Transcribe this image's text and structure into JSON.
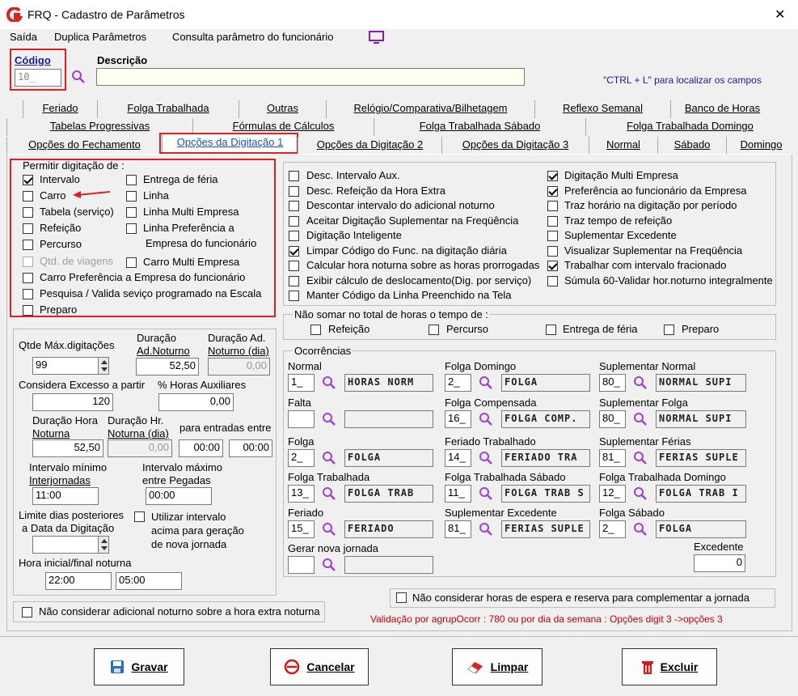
{
  "window": {
    "title": "FRQ - Cadastro de Parâmetros",
    "close": "✕"
  },
  "menu": [
    "Saída",
    "Duplica Parâmetros",
    "Consulta parâmetro do funcionário"
  ],
  "header": {
    "codigo_label": "Código",
    "codigo_value": "10_",
    "descricao_label": "Descrição",
    "descricao_value": "",
    "hint": "\"CTRL + L\" para localizar os campos"
  },
  "tabs_row1": [
    "Feriado",
    "Folga Trabalhada",
    "Outras",
    "Relógio/Comparativa/Bilhetagem",
    "Reflexo Semanal",
    "Banco de Horas"
  ],
  "tabs_row2": [
    "Tabelas Progressivas",
    "Fórmulas de Cálculos",
    "Folga Trabalhada Sábado",
    "Folga Trabalhada Domingo"
  ],
  "tabs_row3": [
    "Opções do Fechamento",
    "Opções da Digitação 1",
    "Opções da Digitação 2",
    "Opções da Digitação 3",
    "Normal",
    "Sábado",
    "Domingo"
  ],
  "permitir": {
    "title": "Permitir digitação de :",
    "left": [
      {
        "label": "Intervalo",
        "checked": true
      },
      {
        "label": "Carro",
        "checked": false
      },
      {
        "label": "Tabela (serviço)",
        "checked": false
      },
      {
        "label": "Refeição",
        "checked": false
      },
      {
        "label": "Percurso",
        "checked": false
      },
      {
        "label": "Qtd. de viagens",
        "checked": false,
        "disabled": true
      }
    ],
    "right": [
      {
        "label": "Entrega de féria",
        "checked": false
      },
      {
        "label": "Linha",
        "checked": false
      },
      {
        "label": "Linha Multi Empresa",
        "checked": false
      },
      {
        "label": "Linha Preferência a",
        "label2": "Empresa do funcionário",
        "checked": false
      },
      {
        "label": "Carro Multi Empresa",
        "checked": false
      }
    ],
    "bottom": [
      {
        "label": "Carro Preferência a Empresa do funcionário",
        "checked": false
      },
      {
        "label": "Pesquisa / Valida seviço programado na Escala",
        "checked": false
      },
      {
        "label": "Preparo",
        "checked": false
      }
    ]
  },
  "options_left": [
    {
      "label": "Desc. Intervalo Aux.",
      "checked": false
    },
    {
      "label": "Desc. Refeição da Hora Extra",
      "checked": false
    },
    {
      "label": "Descontar intervalo do adicional noturno",
      "checked": false
    },
    {
      "label": "Aceitar Digitação Suplementar na Freqüência",
      "checked": false
    },
    {
      "label": "Digitação Inteligente",
      "checked": false
    },
    {
      "label": "Limpar Código do Func. na digitação diária",
      "checked": true
    },
    {
      "label": "Calcular hora noturna sobre as horas prorrogadas",
      "checked": false
    },
    {
      "label": "Exibir cálculo de deslocamento(Dig. por serviço)",
      "checked": false
    },
    {
      "label": "Manter Código da Linha Preenchido na Tela",
      "checked": false
    }
  ],
  "options_right": [
    {
      "label": "Digitação Multi Empresa",
      "checked": true
    },
    {
      "label": "Preferência ao funcionário da Empresa",
      "checked": true
    },
    {
      "label": "Traz horário na digitação por período",
      "checked": false
    },
    {
      "label": "Traz tempo de refeição",
      "checked": false
    },
    {
      "label": "Suplementar Excedente",
      "checked": false
    },
    {
      "label": "Visualizar Suplementar na Freqüência",
      "checked": false
    },
    {
      "label": "Trabalhar com intervalo fracionado",
      "checked": true
    },
    {
      "label": "Súmula 60-Validar hor.noturno integralmente",
      "checked": false
    }
  ],
  "nao_somar": {
    "title": "Não somar no total de horas o tempo de :",
    "items": [
      "Refeição",
      "Percurso",
      "Entrega de féria",
      "Preparo"
    ]
  },
  "params": {
    "qtde_label": "Qtde Máx.digitações",
    "qtde": "99",
    "dur_ad_not_l1": "Duração",
    "dur_ad_not_l2": "Ad.Noturno",
    "dur_ad_not": "52,50",
    "dur_ad_not_dia_l1": "Duração Ad.",
    "dur_ad_not_dia_l2": "Noturno (dia)",
    "dur_ad_not_dia": "0,00",
    "excesso_label": "Considera Excesso a partir",
    "excesso": "120",
    "horas_aux_label": "% Horas Auxiliares",
    "horas_aux": "0,00",
    "dur_hora_not_l1": "Duração Hora",
    "dur_hora_not_l2": "Noturna",
    "dur_hora_not": "52,50",
    "dur_hr_not_dia_l1": "Duração Hr.",
    "dur_hr_not_dia_l2": "Noturna (dia)",
    "dur_hr_not_dia": "0,00",
    "entradas_label": "para entradas entre",
    "entrada1": "00:00",
    "entrada2": "00:00",
    "int_min_l1": "Intervalo mínimo",
    "int_min_l2": "Interjornadas",
    "int_min": "11:00",
    "int_max_l1": "Intervalo máximo",
    "int_max_l2": "entre Pegadas",
    "int_max": "00:00",
    "limite_l1": "Limite dias posteriores",
    "limite_l2": "a Data da Digitação",
    "limite": "",
    "utilizar_l1": "Utilizar intervalo",
    "utilizar_l2": "acima para geração",
    "utilizar_l3": "de nova jornada",
    "hora_not_label": "Hora inicial/final noturna",
    "hora_ini": "22:00",
    "hora_fim": "05:00"
  },
  "ocorrencias": {
    "title": "Ocorrências",
    "excedente_label": "Excedente",
    "excedente": "0",
    "items": [
      {
        "label": "Normal",
        "code": "1_",
        "desc": "HORAS NORM"
      },
      {
        "label": "Folga Domingo",
        "code": "2_",
        "desc": "FOLGA"
      },
      {
        "label": "Suplementar Normal",
        "code": "80_",
        "desc": "NORMAL SUPI"
      },
      {
        "label": "Falta",
        "code": "",
        "desc": ""
      },
      {
        "label": "Folga Compensada",
        "code": "16_",
        "desc": "FOLGA COMP."
      },
      {
        "label": "Suplementar Folga",
        "code": "80_",
        "desc": "NORMAL SUPI"
      },
      {
        "label": "Folga",
        "code": "2_",
        "desc": "FOLGA"
      },
      {
        "label": "Feriado Trabalhado",
        "code": "14_",
        "desc": "FERIADO TRA"
      },
      {
        "label": "Suplementar Férias",
        "code": "81_",
        "desc": "FERIAS SUPLE"
      },
      {
        "label": "Folga Trabalhada",
        "code": "13_",
        "desc": "FOLGA TRAB"
      },
      {
        "label": "Folga Trabalhada Sábado",
        "code": "11_",
        "desc": "FOLGA TRAB S"
      },
      {
        "label": "Folga Trabalhada Domingo",
        "code": "12_",
        "desc": "FOLGA TRAB I"
      },
      {
        "label": "Feriado",
        "code": "15_",
        "desc": "FERIADO"
      },
      {
        "label": "Suplementar Excedente",
        "code": "81_",
        "desc": "FERIAS SUPLE"
      },
      {
        "label": "Folga Sábado",
        "code": "2_",
        "desc": "FOLGA"
      },
      {
        "label": "Gerar nova jornada",
        "code": "",
        "desc": ""
      }
    ]
  },
  "nao_considerar_espera": "Não considerar horas de espera e reserva para complementar a jornada",
  "nao_considerar_adicional": "Não considerar adicional noturno sobre a hora extra noturna",
  "validacao": "Validação por agrupOcorr : 780 ou  por  dia da semana : Opções digit 3 ->opções 3",
  "buttons": {
    "gravar": "Gravar",
    "cancelar": "Cancelar",
    "limpar": "Limpar",
    "excluir": "Excluir"
  },
  "colors": {
    "accent": "#e02020",
    "link_blue": "#1a1aa0",
    "validacao": "#c00000",
    "menu_icon": "#8a1ab0"
  }
}
